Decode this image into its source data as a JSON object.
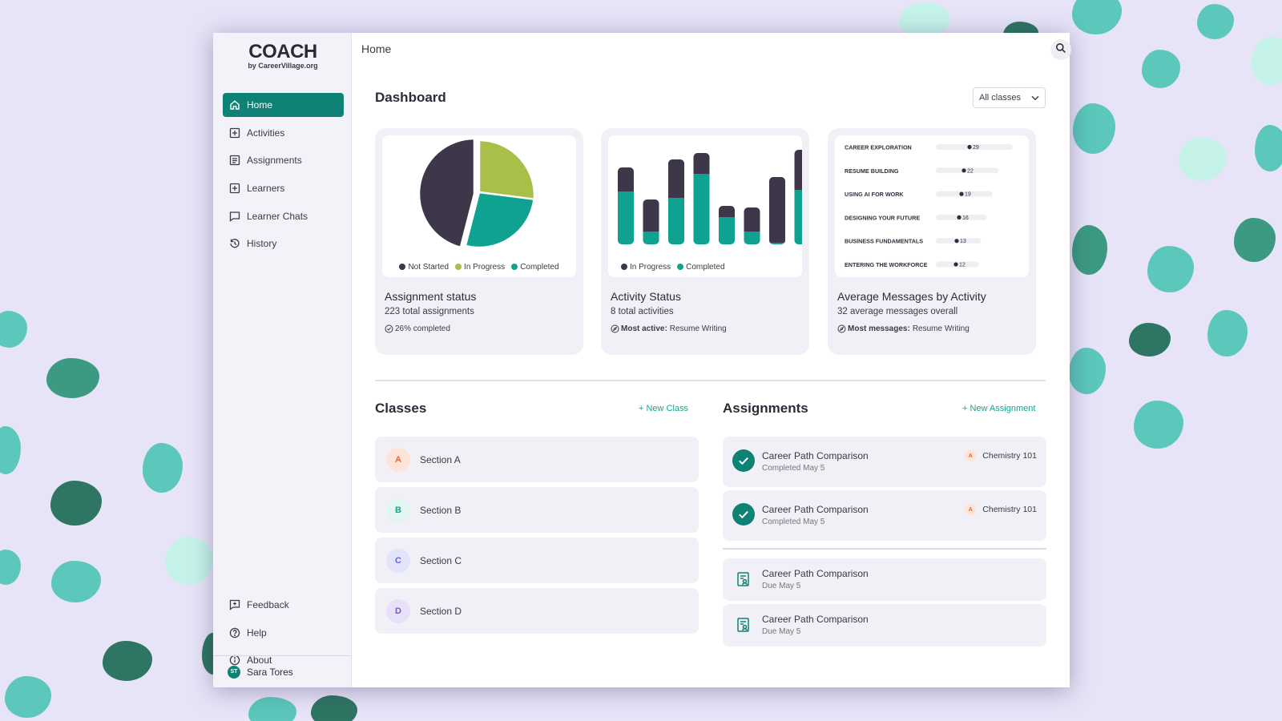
{
  "brand": {
    "name": "COACH",
    "tagline": "by CareerVillage.org"
  },
  "sidebar": {
    "items": [
      {
        "label": "Home",
        "icon": "home-icon",
        "active": true
      },
      {
        "label": "Activities",
        "icon": "plus-square-icon"
      },
      {
        "label": "Assignments",
        "icon": "document-list-icon"
      },
      {
        "label": "Learners",
        "icon": "plus-square-icon"
      },
      {
        "label": "Learner Chats",
        "icon": "chat-bubble-icon"
      },
      {
        "label": "History",
        "icon": "history-icon"
      }
    ],
    "bottom_items": [
      {
        "label": "Feedback",
        "icon": "feedback-icon"
      },
      {
        "label": "Help",
        "icon": "help-circle-icon"
      },
      {
        "label": "About",
        "icon": "info-circle-icon"
      }
    ],
    "user": {
      "initials": "ST",
      "name": "Sara Tores"
    }
  },
  "header": {
    "title": "Home"
  },
  "dashboard": {
    "title": "Dashboard",
    "filter": "All classes",
    "cards": [
      {
        "title": "Assignment status",
        "subtitle": "223 total assignments",
        "note_value": "26% completed"
      },
      {
        "title": "Activity Status",
        "subtitle": "8 total activities",
        "note_label": "Most active:",
        "note_value": "Resume Writing"
      },
      {
        "title": "Average Messages by Activity",
        "subtitle": "32 average messages overall",
        "note_label": "Most messages:",
        "note_value": "Resume Writing"
      }
    ]
  },
  "chart_data": [
    {
      "type": "pie",
      "labels": [
        "Not Started",
        "In Progress",
        "Completed"
      ],
      "values": [
        46,
        27,
        27
      ],
      "colors": [
        "#3d3749",
        "#a8c04a",
        "#0fa291"
      ],
      "legend": [
        "Not Started",
        "In Progress",
        "Completed"
      ]
    },
    {
      "type": "bar",
      "stacked": true,
      "categories": [
        "1",
        "2",
        "3",
        "4",
        "5",
        "6",
        "7",
        "8"
      ],
      "series": [
        {
          "name": "Completed",
          "values": [
            66,
            16,
            58,
            88,
            34,
            16,
            2,
            68
          ],
          "color": "#0fa291"
        },
        {
          "name": "In Progress",
          "values": [
            30,
            40,
            48,
            26,
            14,
            30,
            82,
            50
          ],
          "color": "#3d3749"
        }
      ],
      "legend": [
        "In Progress",
        "Completed"
      ]
    },
    {
      "type": "bar",
      "orientation": "horizontal",
      "categories": [
        "CAREER EXPLORATION",
        "RESUME BUILDING",
        "USING AI FOR WORK",
        "DESIGNING YOUR FUTURE",
        "BUSINESS FUNDAMENTALS",
        "ENTERING THE WORKFORCE"
      ],
      "values": [
        29,
        22,
        19,
        16,
        13,
        12
      ],
      "xlim": [
        0,
        40
      ]
    }
  ],
  "classes": {
    "title": "Classes",
    "new_label": "+ New Class",
    "items": [
      {
        "letter": "A",
        "name": "Section A",
        "bg": "#fde4d6",
        "fg": "#e0673b"
      },
      {
        "letter": "B",
        "name": "Section B",
        "bg": "#e0f6f1",
        "fg": "#1aa08f"
      },
      {
        "letter": "C",
        "name": "Section C",
        "bg": "#e3e4fb",
        "fg": "#5d67d6"
      },
      {
        "letter": "D",
        "name": "Section D",
        "bg": "#e8e0f8",
        "fg": "#7a5ccc"
      }
    ]
  },
  "assignments": {
    "title": "Assignments",
    "new_label": "+ New Assignment",
    "completed": [
      {
        "title": "Career Path Comparison",
        "status": "Completed May 5",
        "class_letter": "A",
        "class_name": "Chemistry 101"
      },
      {
        "title": "Career Path Comparison",
        "status": "Completed May 5",
        "class_letter": "A",
        "class_name": "Chemistry 101"
      }
    ],
    "due": [
      {
        "title": "Career Path Comparison",
        "status": "Due May 5"
      },
      {
        "title": "Career Path Comparison",
        "status": "Due May 5"
      }
    ]
  }
}
